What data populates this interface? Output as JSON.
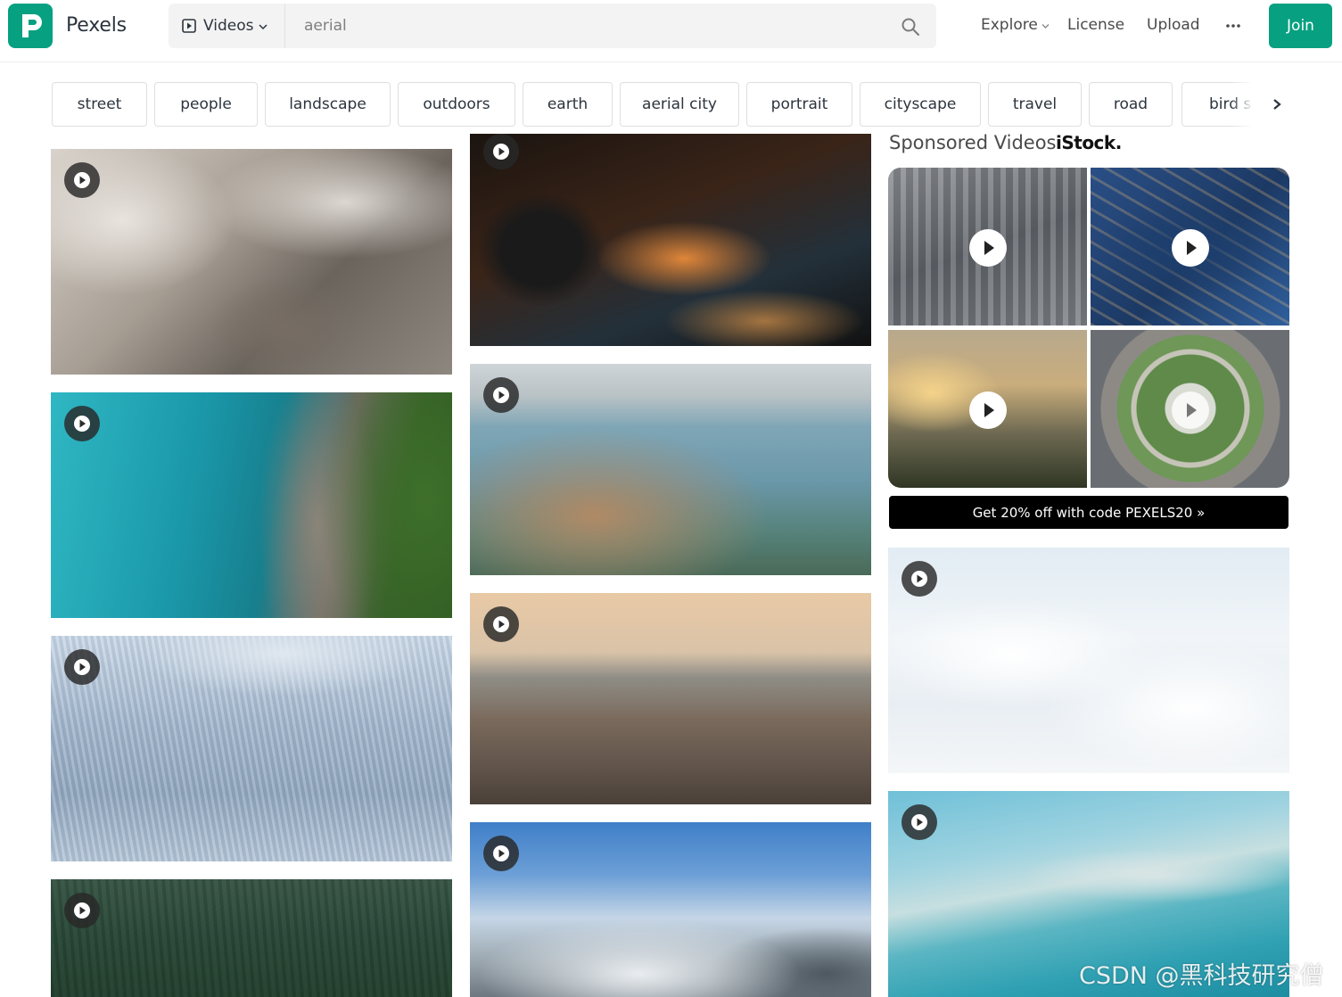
{
  "header": {
    "brand": "Pexels",
    "search": {
      "type_label": "Videos",
      "value": "aerial",
      "placeholder": "aerial"
    },
    "nav": {
      "explore": "Explore",
      "license": "License",
      "upload": "Upload"
    },
    "join_label": "Join"
  },
  "tags": [
    "street",
    "people",
    "landscape",
    "outdoors",
    "earth",
    "aerial city",
    "portrait",
    "cityscape",
    "travel",
    "road",
    "bird s eye"
  ],
  "sponsored": {
    "title": "Sponsored Videos",
    "provider": "iStock.",
    "promo_label": "Get 20% off with code PEXELS20 »"
  },
  "watermark": "CSDN @黑科技研究僧",
  "colors": {
    "brand": "#07a081",
    "text": "#2c343e",
    "promo_bg": "#000000"
  }
}
